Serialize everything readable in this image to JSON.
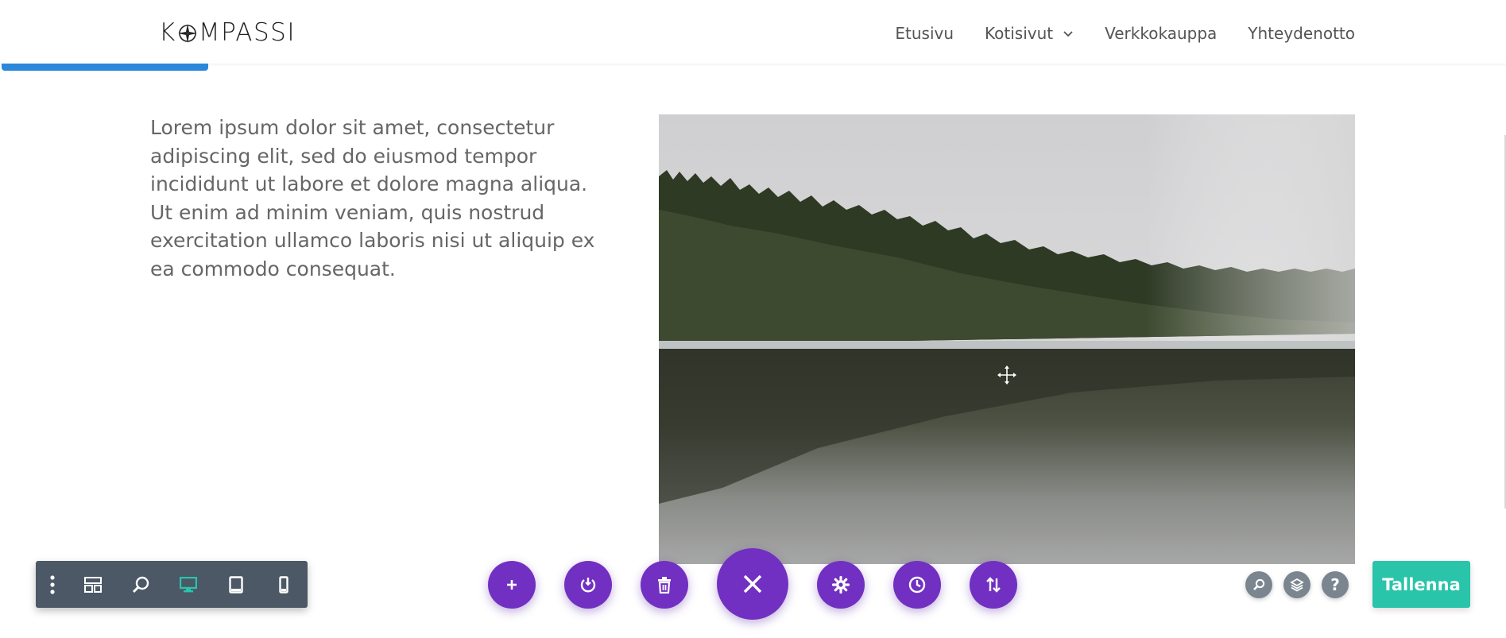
{
  "header": {
    "logo_text": "KOMPASSI",
    "nav": [
      {
        "label": "Etusivu"
      },
      {
        "label": "Kotisivut",
        "has_dropdown": true
      },
      {
        "label": "Verkkokauppa"
      },
      {
        "label": "Yhteydenotto"
      }
    ]
  },
  "content": {
    "paragraph": "Lorem ipsum dolor sit amet, consectetur adipiscing elit, sed do eiusmod tempor incididunt ut labore et dolore magna aliqua. Ut enim ad minim veniam, quis nostrud exercitation ullamco laboris nisi ut aliquip ex ea commodo consequat.",
    "image_subject": "forest lake with reflection"
  },
  "toolbar": {
    "left_icons": [
      "more-vertical-icon",
      "layout-icon",
      "zoom-icon",
      "desktop-icon",
      "tablet-icon",
      "phone-icon"
    ],
    "active_view": "desktop",
    "center_icons": [
      "add-icon",
      "power-icon",
      "trash-icon",
      "close-icon",
      "settings-icon",
      "history-icon",
      "sort-icon"
    ],
    "right_icons": [
      "search-icon",
      "layers-icon",
      "help-icon"
    ],
    "help_glyph": "?",
    "save_label": "Tallenna"
  },
  "colors": {
    "accent_purple": "#7130c1",
    "save_green": "#29c4a9",
    "active_device": "#29c4a9",
    "toolbar_bg": "#4c5866",
    "tab_blue": "#2b87da"
  }
}
